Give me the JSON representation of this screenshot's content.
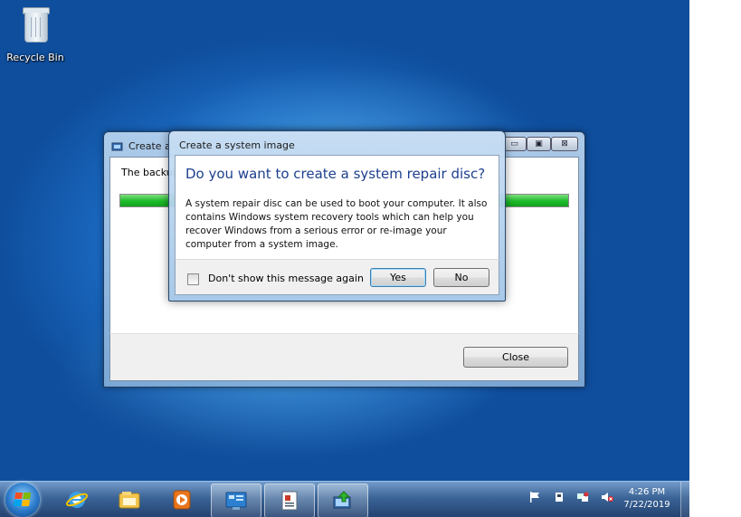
{
  "desktop": {
    "recycle_bin_label": "Recycle Bin"
  },
  "back_window": {
    "title": "Create a",
    "message": "The backup",
    "progress": 1.0,
    "close_label": "Close",
    "minimize_glyph": "▭",
    "maximize_glyph": "▣",
    "close_glyph": "⊠"
  },
  "dialog": {
    "title": "Create a system image",
    "question": "Do you want to create a system repair disc?",
    "body": "A system repair disc can be used to boot your computer. It also contains Windows system recovery tools which can help you recover Windows from a serious error or re-image your computer from a system image.",
    "checkbox_label": "Don't show this message again",
    "checkbox_checked": false,
    "yes_label": "Yes",
    "no_label": "No"
  },
  "taskbar": {
    "pinned": [
      "start-orb",
      "internet-explorer-icon",
      "windows-explorer-icon",
      "media-player-icon",
      "control-panel-icon",
      "document-icon",
      "backup-restore-icon"
    ],
    "clock_time": "4:26 PM",
    "clock_date": "7/22/2019"
  },
  "colors": {
    "question_blue": "#1d3f8f",
    "progress_green": "#1dbb2a"
  }
}
